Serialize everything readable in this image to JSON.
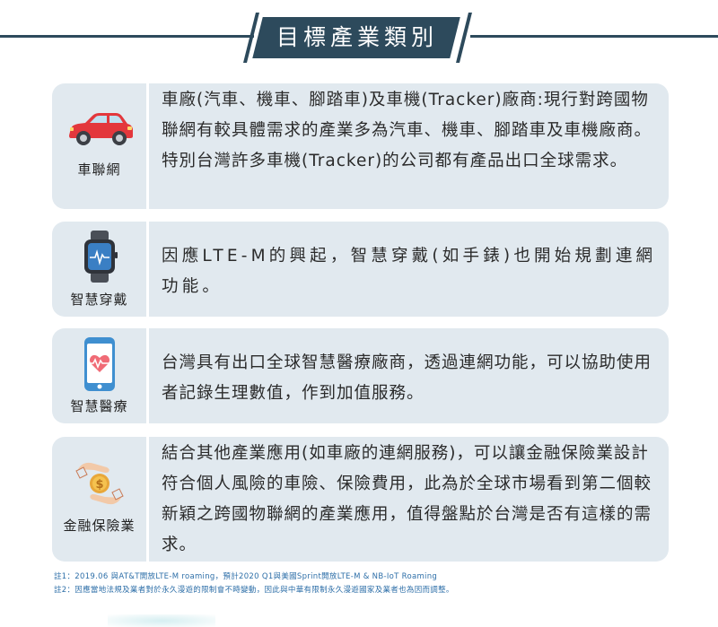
{
  "title": "目標產業類別",
  "colors": {
    "header": "#2d4a5c",
    "card_bg": "#e1e9ef",
    "note_text": "#2e6fa8",
    "car_red": "#e3373c",
    "watch_band": "#4a4f57",
    "coin_gold": "#e8a73a"
  },
  "categories": [
    {
      "icon": "car-icon",
      "label": "車聯網",
      "description": "車廠(汽車、機車、腳踏車)及車機(Tracker)廠商:現行對跨國物聯網有較具體需求的產業多為汽車、機車、腳踏車及車機廠商。特別台灣許多車機(Tracker)的公司都有產品出口全球需求。"
    },
    {
      "icon": "smartwatch-icon",
      "label": "智慧穿戴",
      "description": "因應LTE-M的興起，智慧穿戴(如手錶)也開始規劃連網功能。"
    },
    {
      "icon": "health-phone-icon",
      "label": "智慧醫療",
      "description": "台灣具有出口全球智慧醫療廠商，透過連網功能，可以協助使用者記錄生理數值，作到加值服務。"
    },
    {
      "icon": "finance-coin-icon",
      "label": "金融保險業",
      "description": "結合其他產業應用(如車廠的連網服務)，可以讓金融保險業設計符合個人風險的車險、保險費用，此為於全球市場看到第二個較新穎之跨國物聯網的產業應用，值得盤點於台灣是否有這樣的需求。"
    }
  ],
  "notes": [
    "註1：2019.06 與AT&T開放LTE-M roaming，預計2020 Q1與美國Sprint開放LTE-M & NB-IoT Roaming",
    "註2：因應當地法規及業者對於永久漫遊的限制會不時變動，因此與中華有限制永久漫遊國家及業者也為因而調整。"
  ]
}
